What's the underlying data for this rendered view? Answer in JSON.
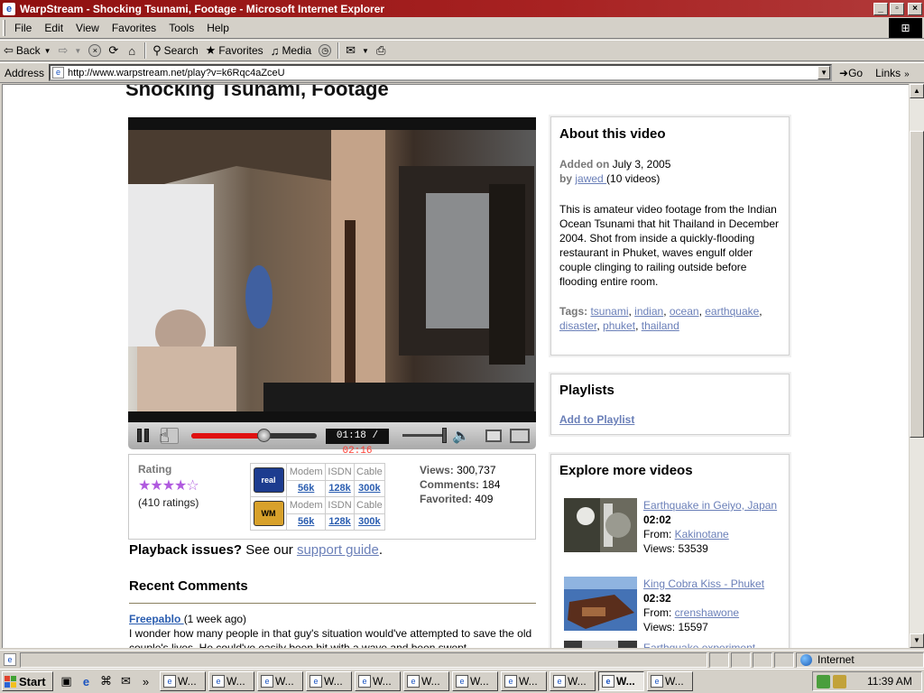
{
  "window": {
    "title": "WarpStream - Shocking Tsunami, Footage - Microsoft Internet Explorer",
    "app_icon": "e",
    "minimize": "_",
    "maximize": "▫",
    "close": "×"
  },
  "menu": {
    "items": [
      "File",
      "Edit",
      "View",
      "Favorites",
      "Tools",
      "Help"
    ]
  },
  "toolbar": {
    "back_label": "Back",
    "search_label": "Search",
    "favorites_label": "Favorites",
    "media_label": "Media"
  },
  "address": {
    "label": "Address",
    "url": "http://www.warpstream.net/play?v=k6Rqc4aZceU",
    "go_label": "Go",
    "links_label": "Links"
  },
  "page": {
    "title": "Shocking Tsunami, Footage",
    "player": {
      "current_time": "01:18",
      "separator": " / ",
      "total_time": "02:16",
      "progress_fraction": 0.58,
      "volume_fraction": 0.95
    },
    "rating": {
      "label": "Rating",
      "stars_text": "★★★★☆",
      "count": "(410 ratings)"
    },
    "formats": {
      "headers": [
        "Modem",
        "ISDN",
        "Cable"
      ],
      "links": [
        "56k",
        "128k",
        "300k"
      ],
      "real_logo_text": "real",
      "wm_logo_text": "WM"
    },
    "stats": {
      "views_label": "Views:",
      "views_value": "300,737",
      "comments_label": "Comments:",
      "comments_value": "184",
      "favorited_label": "Favorited:",
      "favorited_value": "409"
    },
    "playback": {
      "bold": "Playback issues?",
      "text": " See our ",
      "link": "support guide",
      "end": "."
    },
    "recent_comments": {
      "title": "Recent Comments",
      "user": "Freepablo ",
      "time": "(1 week ago)",
      "text": "I wonder how many people in that guy's situation would've attempted to save the old couple's lives. He could've easily been hit with a wave and been swept"
    },
    "about": {
      "title": "About this video",
      "added_label": "Added on",
      "added_date": " July 3, 2005",
      "by_label": "by",
      "by_user": "jawed ",
      "video_count": "(10 videos)",
      "description": "This is amateur video footage from the Indian Ocean Tsunami that hit Thailand in December 2004. Shot from inside a quickly-flooding restaurant in Phuket, waves engulf older couple clinging to railing outside before flooding entire room.",
      "tags_label": "Tags:",
      "tags": [
        "tsunami",
        "indian",
        "ocean",
        "earthquake",
        "disaster",
        "phuket",
        "thailand"
      ]
    },
    "playlists": {
      "title": "Playlists",
      "add_label": "Add to Playlist"
    },
    "explore": {
      "title": "Explore more videos",
      "from_label": "From: ",
      "views_label": "Views: ",
      "videos": [
        {
          "title": "Earthquake in Geiyo, Japan",
          "duration": "02:02",
          "from": "Kakinotane",
          "views": "53539"
        },
        {
          "title": "King Cobra Kiss - Phuket",
          "duration": "02:32",
          "from": "crenshawone",
          "views": "15597"
        },
        {
          "title": "Earthquake experiment",
          "duration": "",
          "from": "",
          "views": ""
        }
      ]
    }
  },
  "statusbar": {
    "zone": "Internet"
  },
  "taskbar": {
    "start_label": "Start",
    "task_label": "W...",
    "task_count": 11,
    "active_index": 9,
    "clock": "11:39 AM"
  }
}
